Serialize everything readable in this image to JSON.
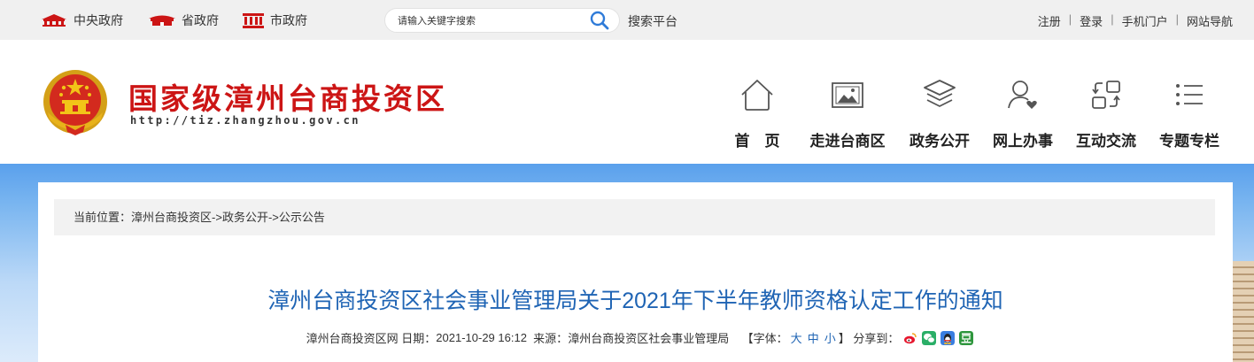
{
  "topbar": {
    "links": [
      {
        "label": "中央政府",
        "icon": "central-government-icon"
      },
      {
        "label": "省政府",
        "icon": "provincial-government-icon"
      },
      {
        "label": "市政府",
        "icon": "city-government-icon"
      }
    ],
    "search_placeholder": "请输入关键字搜索",
    "search_platform": "搜索平台",
    "user_links": [
      "注册",
      "登录",
      "手机门户",
      "网站导航"
    ],
    "separator": "|"
  },
  "header": {
    "site_title": "国家级漳州台商投资区",
    "site_url": "http://tiz.zhangzhou.gov.cn",
    "nav": [
      {
        "label": "首　页",
        "icon": "home-icon"
      },
      {
        "label": "走进台商区",
        "icon": "picture-icon"
      },
      {
        "label": "政务公开",
        "icon": "layers-icon"
      },
      {
        "label": "网上办事",
        "icon": "user-heart-icon"
      },
      {
        "label": "互动交流",
        "icon": "exchange-icon"
      },
      {
        "label": "专题专栏",
        "icon": "list-icon"
      }
    ]
  },
  "breadcrumb": {
    "prefix": "当前位置：",
    "items": [
      "漳州台商投资区",
      "政务公开",
      "公示公告"
    ],
    "separator": "->"
  },
  "article": {
    "title": "漳州台商投资区社会事业管理局关于2021年下半年教师资格认定工作的通知",
    "site": "漳州台商投资区网",
    "date_label": "日期：",
    "date": "2021-10-29 16:12",
    "source_label": "来源：",
    "source": "漳州台商投资区社会事业管理局",
    "font_label_open": "【字体：",
    "font_sizes": [
      "大",
      "中",
      "小"
    ],
    "font_label_close": "】",
    "share_label": "分享到：",
    "share_icons": [
      "weibo-icon",
      "wechat-icon",
      "qq-icon",
      "douban-icon"
    ]
  },
  "colors": {
    "brand_red": "#cc1515",
    "title_blue": "#1f64b4",
    "topbar_bg": "#f0f0f0"
  }
}
